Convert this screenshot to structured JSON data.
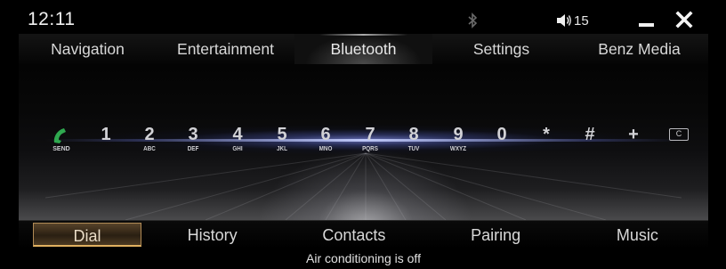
{
  "status_bar": {
    "time": "12:11",
    "bluetooth_icon": "bluetooth-icon",
    "volume_icon": "speaker-icon",
    "volume_level": "15",
    "minimize_icon": "minimize-icon",
    "close_icon": "close-icon"
  },
  "top_menu": {
    "items": [
      {
        "label": "Navigation",
        "active": false
      },
      {
        "label": "Entertainment",
        "active": false
      },
      {
        "label": "Bluetooth",
        "active": true
      },
      {
        "label": "Settings",
        "active": false
      },
      {
        "label": "Benz Media",
        "active": false
      }
    ]
  },
  "keypad": {
    "send": {
      "icon": "phone-icon",
      "label": "SEND",
      "color": "#2fa84f"
    },
    "keys": [
      {
        "digit": "1",
        "letters": ""
      },
      {
        "digit": "2",
        "letters": "ABC"
      },
      {
        "digit": "3",
        "letters": "DEF"
      },
      {
        "digit": "4",
        "letters": "GHI"
      },
      {
        "digit": "5",
        "letters": "JKL"
      },
      {
        "digit": "6",
        "letters": "MNO"
      },
      {
        "digit": "7",
        "letters": "PQRS"
      },
      {
        "digit": "8",
        "letters": "TUV"
      },
      {
        "digit": "9",
        "letters": "WXYZ"
      },
      {
        "digit": "0",
        "letters": ""
      },
      {
        "digit": "*",
        "letters": ""
      },
      {
        "digit": "#",
        "letters": ""
      },
      {
        "digit": "+",
        "letters": ""
      }
    ],
    "clear": {
      "label": "C"
    }
  },
  "bottom_tabs": {
    "items": [
      {
        "label": "Dial",
        "selected": true
      },
      {
        "label": "History",
        "selected": false
      },
      {
        "label": "Contacts",
        "selected": false
      },
      {
        "label": "Pairing",
        "selected": false
      },
      {
        "label": "Music",
        "selected": false
      }
    ]
  },
  "footer": {
    "status_text": "Air conditioning is off"
  },
  "colors": {
    "accent_gold": "#b08a55",
    "glow_blue": "#7880c8",
    "send_green": "#2fa84f"
  }
}
